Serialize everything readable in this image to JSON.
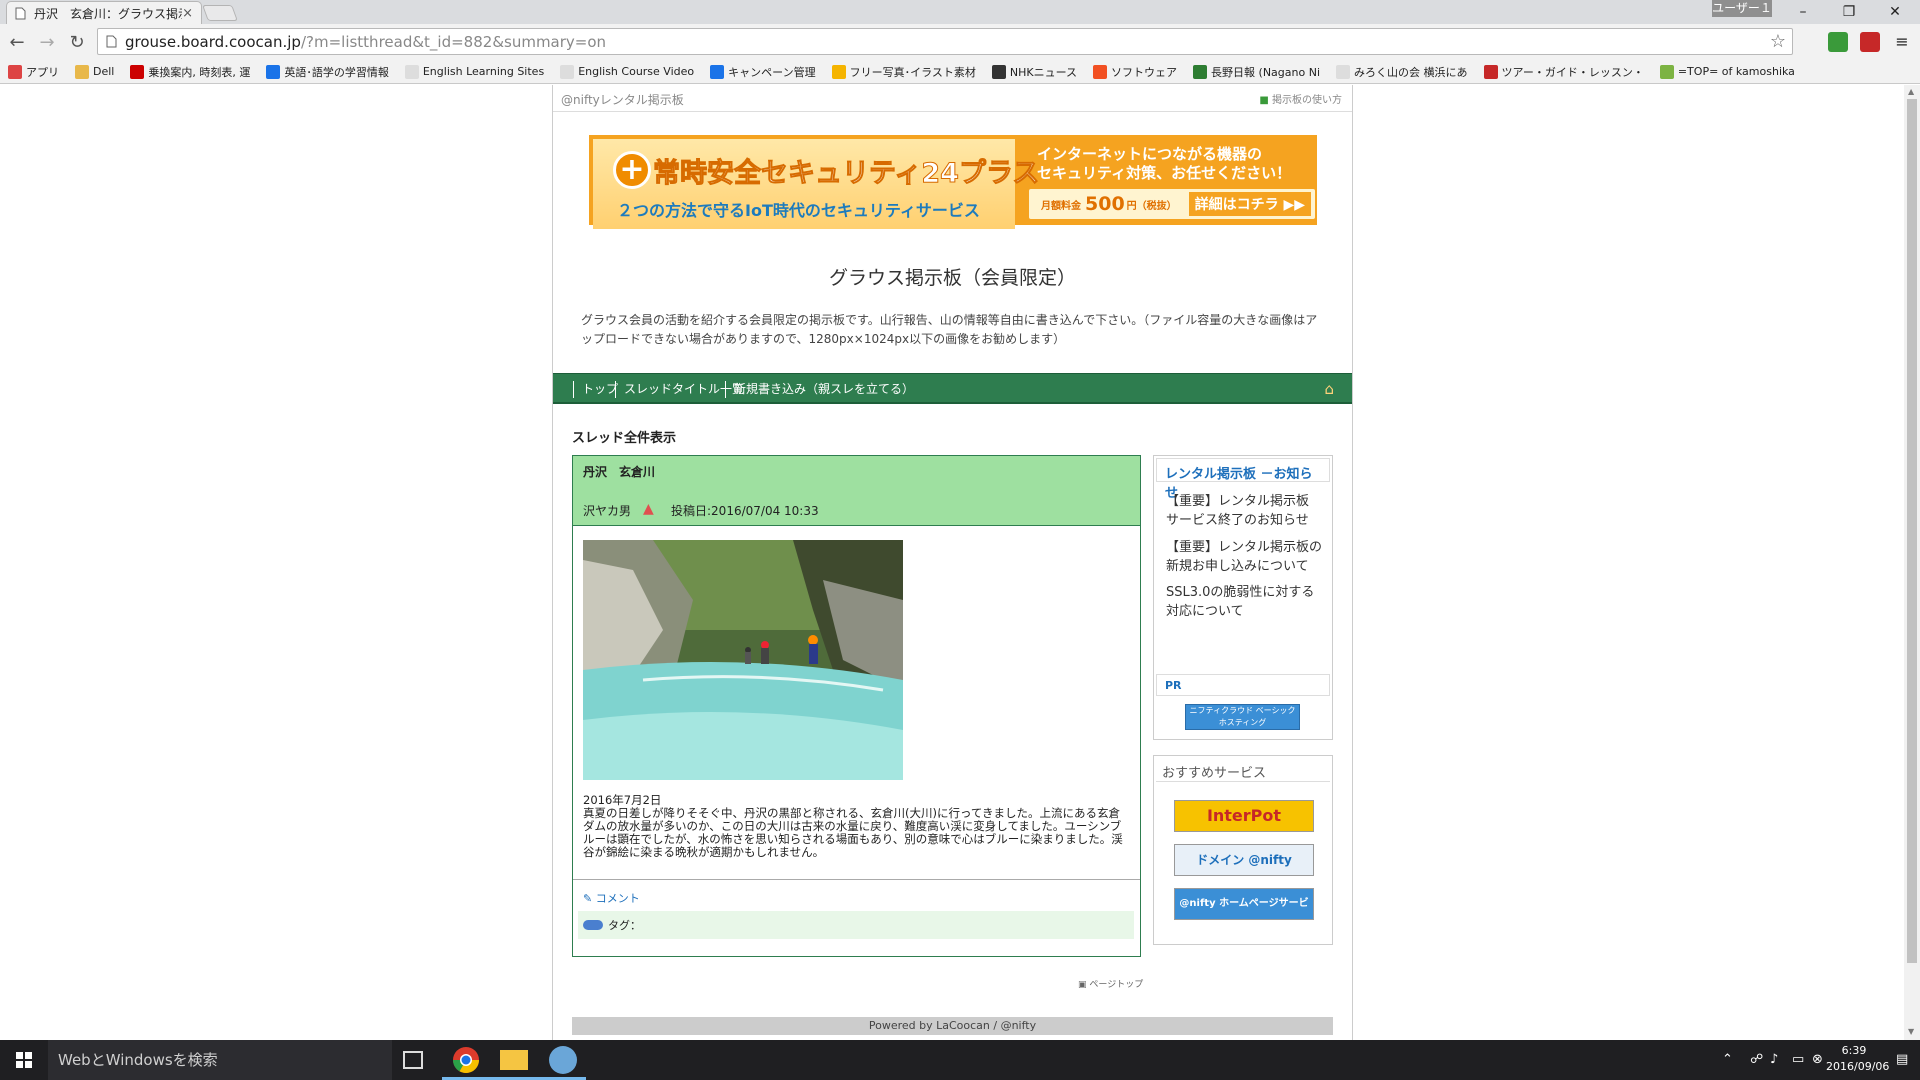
{
  "browser": {
    "tab_title": "丹沢　玄倉川：グラウス掲示",
    "tab_close": "×",
    "user_label": "ユーザー１",
    "minimize": "–",
    "restore": "❐",
    "close": "✕",
    "url_host": "grouse.board.coocan.jp",
    "url_path": "/?m=listthread&t_id=882&summary=on",
    "star": "☆"
  },
  "bookmarks": [
    {
      "label": "アプリ",
      "color": "#d44"
    },
    {
      "label": "Dell",
      "color": "#e8b84a"
    },
    {
      "label": "乗換案内, 時刻表, 運",
      "color": "#c00"
    },
    {
      "label": "英語･語学の学習情報",
      "color": "#1a73e8"
    },
    {
      "label": "English Learning Sites",
      "color": "#ddd"
    },
    {
      "label": "English Course Video",
      "color": "#ddd"
    },
    {
      "label": "キャンペーン管理",
      "color": "#1a73e8"
    },
    {
      "label": "フリー写真･イラスト素材",
      "color": "#f5b400"
    },
    {
      "label": "NHKニュース",
      "color": "#333"
    },
    {
      "label": "ソフトウェア",
      "color": "#f25022"
    },
    {
      "label": "長野日報 (Nagano Ni",
      "color": "#2e7d32"
    },
    {
      "label": "みろく山の会 横浜にあ",
      "color": "#ddd"
    },
    {
      "label": "ツアー・ガイド・レッスン・",
      "color": "#c62828"
    },
    {
      "label": "=TOP= of kamoshika",
      "color": "#7cb342"
    }
  ],
  "site": {
    "service_name": "@niftyレンタル掲示板",
    "help_link": "掲示板の使い方",
    "board_title": "グラウス掲示板（会員限定）",
    "board_desc": "グラウス会員の活動を紹介する会員限定の掲示板です。山行報告、山の情報等自由に書き込んで下さい。（ファイル容量の大きな画像はアップロードできない場合がありますので、1280px×1024px以下の画像をお勧めします）",
    "nav": [
      "トップ",
      "スレッドタイトル一覧",
      "新規書き込み（親スレを立てる）"
    ],
    "home_icon": "⌂",
    "section_title": "スレッド全件表示"
  },
  "banner": {
    "title": "常時安全セキュリティ24プラス",
    "plus": "+",
    "subtitle": "２つの方法で守るIoT時代のセキュリティサービス",
    "message": "インターネットにつながる機器の\nセキュリティ対策、お任せください！",
    "price_prefix": "月額料金",
    "price": "500",
    "price_unit": "円（税抜）",
    "detail": "詳細はコチラ ▶▶"
  },
  "thread": {
    "subject": "丹沢　玄倉川",
    "author": "沢ヤカ男",
    "author_icon": "▲",
    "date": "投稿日:2016/07/04 10:33",
    "body_date": "2016年7月2日",
    "body": "真夏の日差しが降りそそぐ中、丹沢の黒部と称される、玄倉川(大川)に行ってきました。上流にある玄倉ダムの放水量が多いのか、この日の大川は古来の水量に戻り、難度高い渓に変身してました。ユーシンブルーは顕在でしたが、水の怖さを思い知らされる場面もあり、別の意味で心はブルーに染まりました。渓谷が錦絵に染まる晩秋が適期かもしれません。",
    "comment_link": "コメント",
    "tag_label": "タグ："
  },
  "sidebar": {
    "news_title": "レンタル掲示板 －お知らせ",
    "news": [
      "【重要】レンタル掲示板 サービス終了のお知らせ",
      "【重要】レンタル掲示板の新規お申し込みについて",
      "SSL3.0の脆弱性に対する対応について"
    ],
    "pr_title": "PR",
    "pr_banner": "ニフティクラウド ベーシックホスティング",
    "recommend_title": "おすすめサービス",
    "services": [
      {
        "label": "InterPot",
        "color": "#f7c200"
      },
      {
        "label": "ドメイン @nifty",
        "color": "#e8f0f8"
      },
      {
        "label": "@nifty ホームページサービス",
        "color": "#3b8fd6"
      }
    ]
  },
  "footer": {
    "page_top": "ページトップ",
    "powered": "Powered by LaCoocan / @nifty"
  },
  "taskbar": {
    "search_placeholder": "WebとWindowsを検索",
    "time": "6:39",
    "date": "2016/09/06"
  }
}
